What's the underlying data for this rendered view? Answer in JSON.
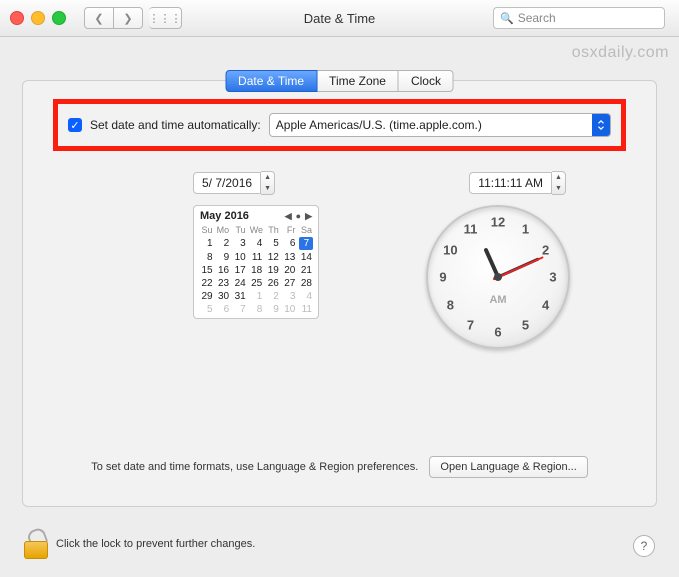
{
  "title": "Date & Time",
  "search_placeholder": "Search",
  "watermark": "osxdaily.com",
  "tabs": {
    "dt": "Date & Time",
    "tz": "Time Zone",
    "clk": "Clock"
  },
  "auto": {
    "label": "Set date and time automatically:",
    "server": "Apple Americas/U.S. (time.apple.com.)"
  },
  "date_field": "5/  7/2016",
  "time_field": "11:11:11 AM",
  "calendar": {
    "header": "May 2016",
    "dows": [
      "Su",
      "Mo",
      "Tu",
      "We",
      "Th",
      "Fr",
      "Sa"
    ],
    "weeks": [
      [
        {
          "d": "1"
        },
        {
          "d": "2"
        },
        {
          "d": "3"
        },
        {
          "d": "4"
        },
        {
          "d": "5"
        },
        {
          "d": "6"
        },
        {
          "d": "7",
          "sel": true
        }
      ],
      [
        {
          "d": "8"
        },
        {
          "d": "9"
        },
        {
          "d": "10"
        },
        {
          "d": "11"
        },
        {
          "d": "12"
        },
        {
          "d": "13"
        },
        {
          "d": "14"
        }
      ],
      [
        {
          "d": "15"
        },
        {
          "d": "16"
        },
        {
          "d": "17"
        },
        {
          "d": "18"
        },
        {
          "d": "19"
        },
        {
          "d": "20"
        },
        {
          "d": "21"
        }
      ],
      [
        {
          "d": "22"
        },
        {
          "d": "23"
        },
        {
          "d": "24"
        },
        {
          "d": "25"
        },
        {
          "d": "26"
        },
        {
          "d": "27"
        },
        {
          "d": "28"
        }
      ],
      [
        {
          "d": "29"
        },
        {
          "d": "30"
        },
        {
          "d": "31"
        },
        {
          "d": "1",
          "dim": true
        },
        {
          "d": "2",
          "dim": true
        },
        {
          "d": "3",
          "dim": true
        },
        {
          "d": "4",
          "dim": true
        }
      ],
      [
        {
          "d": "5",
          "dim": true
        },
        {
          "d": "6",
          "dim": true
        },
        {
          "d": "7",
          "dim": true
        },
        {
          "d": "8",
          "dim": true
        },
        {
          "d": "9",
          "dim": true
        },
        {
          "d": "10",
          "dim": true
        },
        {
          "d": "11",
          "dim": true
        }
      ]
    ]
  },
  "clock": {
    "ampm": "AM",
    "numbers": [
      "12",
      "1",
      "2",
      "3",
      "4",
      "5",
      "6",
      "7",
      "8",
      "9",
      "10",
      "11"
    ]
  },
  "formats_text": "To set date and time formats, use Language & Region preferences.",
  "open_lang_btn": "Open Language & Region...",
  "lock_text": "Click the lock to prevent further changes.",
  "help": "?"
}
